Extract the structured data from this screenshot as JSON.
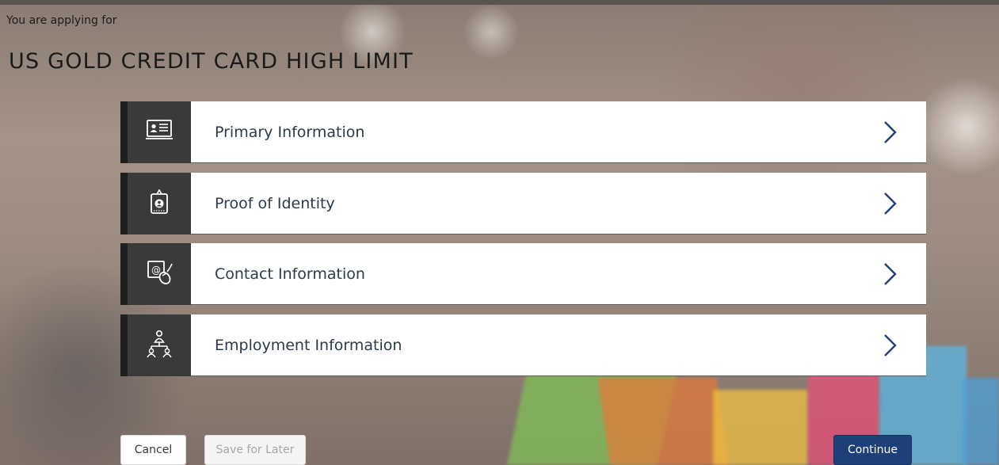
{
  "header": {
    "applying_label": "You are applying for",
    "product_name": "US GOLD CREDIT CARD HIGH LIMIT"
  },
  "sections": [
    {
      "label": "Primary Information",
      "icon": "id-card-icon"
    },
    {
      "label": "Proof of Identity",
      "icon": "id-badge-icon"
    },
    {
      "label": "Contact Information",
      "icon": "email-mouse-icon"
    },
    {
      "label": "Employment Information",
      "icon": "org-chart-icon"
    }
  ],
  "actions": {
    "cancel_label": "Cancel",
    "save_label": "Save for Later",
    "continue_label": "Continue"
  },
  "colors": {
    "primary_button": "#1f3f78",
    "icon_box": "#3a3a3a",
    "label_text": "#2b3a4c"
  }
}
